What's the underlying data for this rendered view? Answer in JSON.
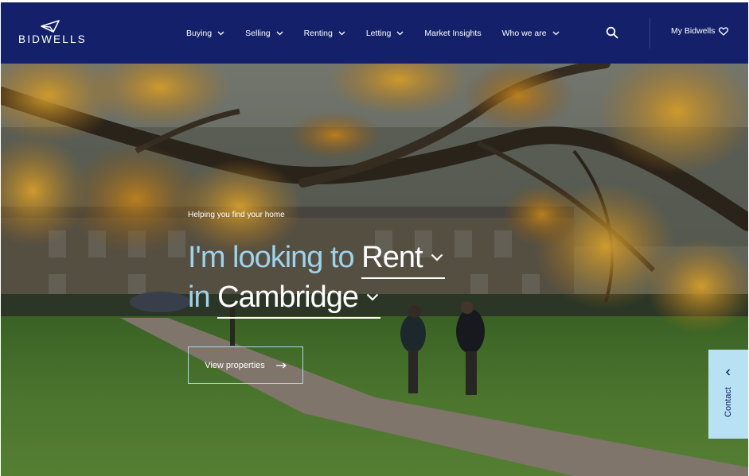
{
  "brand": {
    "name": "BIDWELLS",
    "logo_icon": "paper-plane-logo-icon"
  },
  "nav": {
    "items": [
      {
        "label": "Buying",
        "has_dropdown": true
      },
      {
        "label": "Selling",
        "has_dropdown": true
      },
      {
        "label": "Renting",
        "has_dropdown": true
      },
      {
        "label": "Letting",
        "has_dropdown": true
      },
      {
        "label": "Market Insights",
        "has_dropdown": false
      },
      {
        "label": "Who we are",
        "has_dropdown": true
      }
    ],
    "search_icon": "search-icon",
    "account_label": "My Bidwells",
    "account_icon": "heart-icon"
  },
  "hero": {
    "tagline": "Helping you find your home",
    "line1_prefix": "I'm looking to",
    "intent_value": "Rent",
    "line2_prefix": "in",
    "location_value": "Cambridge",
    "cta_label": "View properties",
    "cta_icon": "arrow-right-icon"
  },
  "contact_tab": {
    "label": "Contact",
    "icon": "chevron-left-icon"
  },
  "colors": {
    "nav_bg": "#14216a",
    "accent_light_blue": "#9fd3ec",
    "contact_bg": "#b8e2f4"
  }
}
